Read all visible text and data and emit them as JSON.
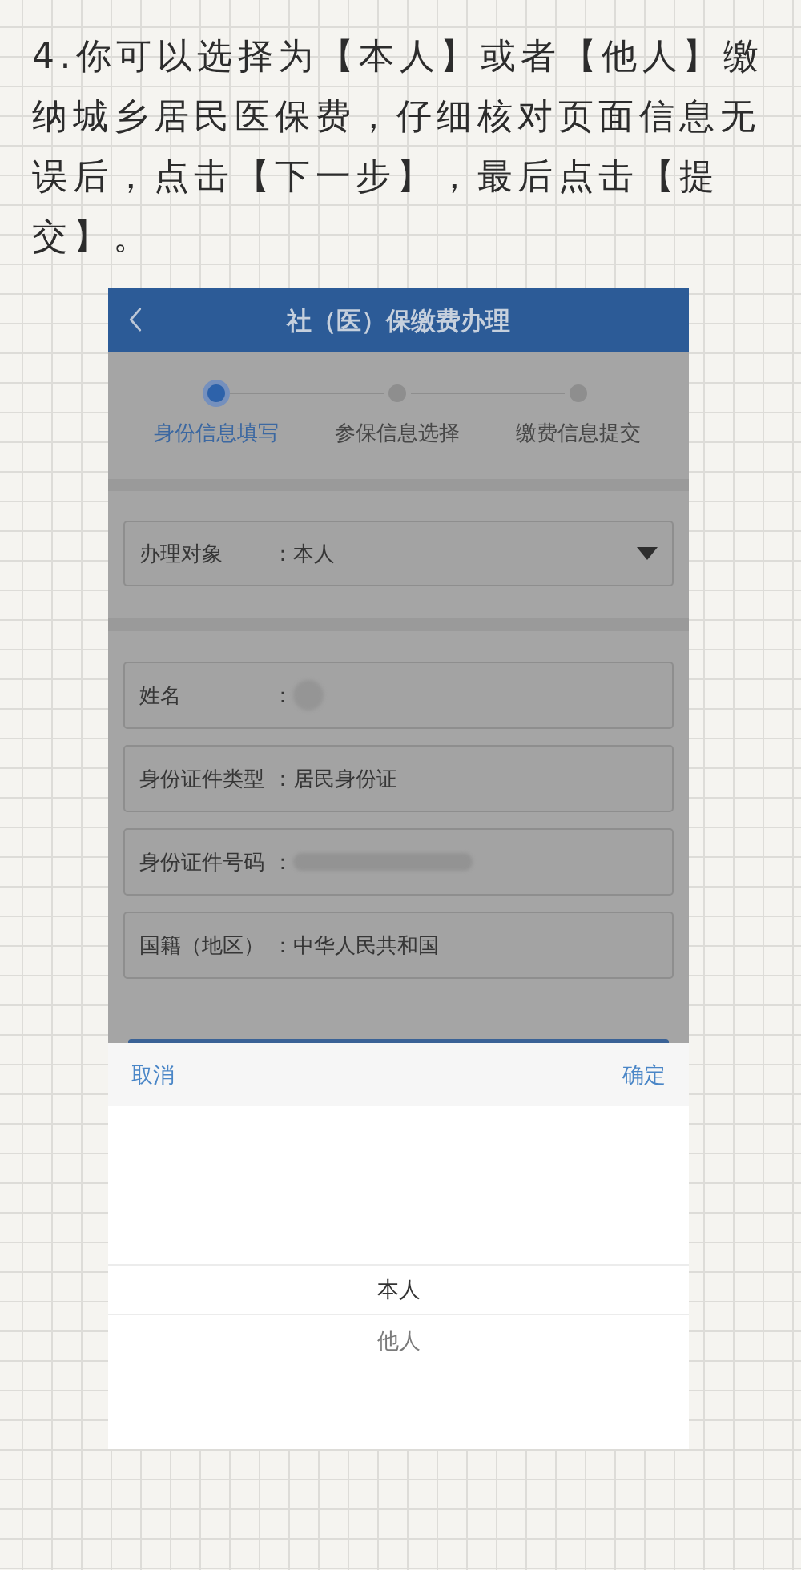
{
  "instruction": "4.你可以选择为【本人】或者【他人】缴纳城乡居民医保费，仔细核对页面信息无误后，点击【下一步】，最后点击【提交】。",
  "phone": {
    "header": {
      "title": "社（医）保缴费办理"
    },
    "steps": [
      {
        "label": "身份信息填写",
        "selected": true
      },
      {
        "label": "参保信息选择",
        "selected": false
      },
      {
        "label": "缴费信息提交",
        "selected": false
      }
    ],
    "select_field": {
      "label": "办理对象",
      "colon": "：",
      "value": "本人"
    },
    "fields": [
      {
        "kind": "blurdot",
        "label": "姓名",
        "colon": "："
      },
      {
        "kind": "text",
        "label": "身份证件类型",
        "colon": "：",
        "value": "居民身份证"
      },
      {
        "kind": "blurbar",
        "label": "身份证件号码",
        "colon": "："
      },
      {
        "kind": "text",
        "label": "国籍（地区）",
        "colon": "：",
        "value": "中华人民共和国"
      }
    ],
    "picker": {
      "open": true,
      "cancel": "取消",
      "confirm": "确定",
      "options": [
        {
          "label": "本人",
          "selected": true
        },
        {
          "label": "他人",
          "selected": false
        }
      ]
    }
  }
}
